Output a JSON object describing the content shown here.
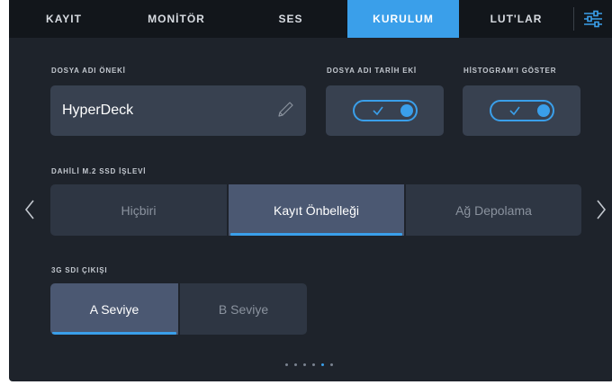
{
  "tabs": [
    {
      "label": "KAYIT"
    },
    {
      "label": "MONİTÖR"
    },
    {
      "label": "SES"
    },
    {
      "label": "KURULUM"
    },
    {
      "label": "LUT'LAR"
    }
  ],
  "active_tab": "KURULUM",
  "menu_icon": "sliders-icon",
  "settings": {
    "filename_prefix": {
      "label": "DOSYA ADI ÖNEKİ",
      "value": "HyperDeck"
    },
    "filename_date_suffix": {
      "label": "DOSYA ADI TARİH EKİ",
      "enabled": true
    },
    "show_histogram": {
      "label": "HİSTOGRAM'I GÖSTER",
      "enabled": true
    },
    "m2_ssd_function": {
      "label": "DAHİLİ M.2 SSD İŞLEVİ",
      "options": [
        "Hiçbiri",
        "Kayıt Önbelleği",
        "Ağ Depolama"
      ],
      "selected": "Kayıt Önbelleği"
    },
    "sdi_3g_output": {
      "label": "3G SDI ÇIKIŞI",
      "options": [
        "A Seviye",
        "B Seviye"
      ],
      "selected": "A Seviye"
    }
  },
  "pagination": {
    "total": 6,
    "current": 5
  },
  "colors": {
    "accent": "#3a9fea",
    "background": "#1e232b",
    "tabbar": "#12161b"
  }
}
